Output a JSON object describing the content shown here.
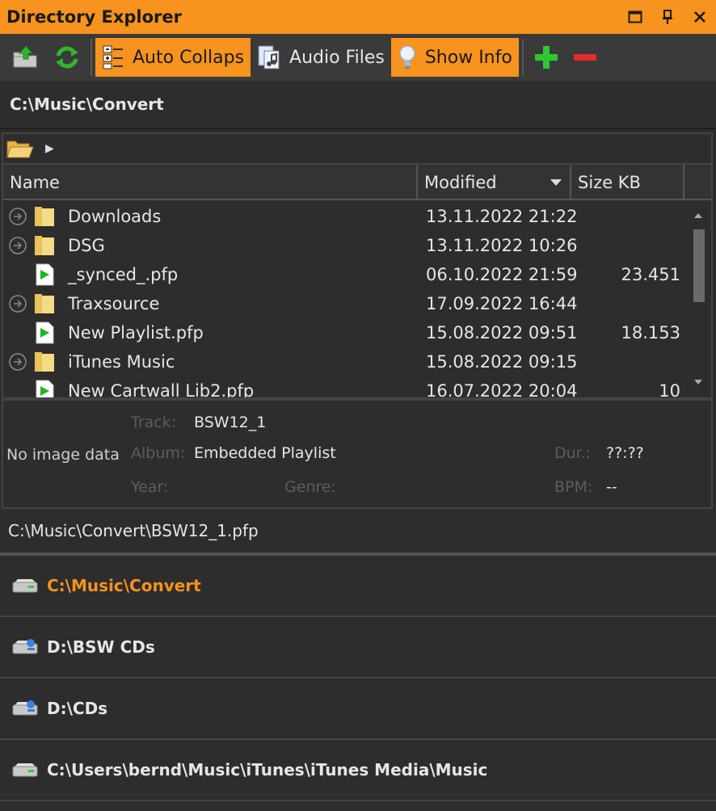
{
  "window": {
    "title": "Directory Explorer",
    "controls": [
      "maximize-icon",
      "pin-icon",
      "close-icon"
    ]
  },
  "toolbar": {
    "auto_collapse": "Auto Collaps",
    "audio_files": "Audio Files",
    "show_info": "Show Info"
  },
  "current_path": "C:\\Music\\Convert",
  "list": {
    "headers": {
      "name": "Name",
      "modified": "Modified",
      "size": "Size KB"
    },
    "rows": [
      {
        "type": "folder",
        "name": "Downloads",
        "modified": "13.11.2022 21:22",
        "size": ""
      },
      {
        "type": "folder",
        "name": "DSG",
        "modified": "13.11.2022 10:26",
        "size": ""
      },
      {
        "type": "playlist",
        "name": "_synced_.pfp",
        "modified": "06.10.2022 21:59",
        "size": "23.451"
      },
      {
        "type": "folder",
        "name": "Traxsource",
        "modified": "17.09.2022 16:44",
        "size": ""
      },
      {
        "type": "playlist",
        "name": "New Playlist.pfp",
        "modified": "15.08.2022 09:51",
        "size": "18.153"
      },
      {
        "type": "folder",
        "name": "iTunes Music",
        "modified": "15.08.2022 09:15",
        "size": ""
      },
      {
        "type": "playlist",
        "name": "New Cartwall Lib2.pfp",
        "modified": "16.07.2022 20:04",
        "size": "10"
      }
    ]
  },
  "info": {
    "no_image": "No image data",
    "track_label": "Track:",
    "track": "BSW12_1",
    "album_label": "Album:",
    "album": "Embedded Playlist",
    "year_label": "Year:",
    "genre_label": "Genre:",
    "dur_label": "Dur.:",
    "dur": "??:??",
    "bpm_label": "BPM:",
    "bpm": "--"
  },
  "selected_file_path": "C:\\Music\\Convert\\BSW12_1.pfp",
  "locations": [
    {
      "path": "C:\\Music\\Convert",
      "drive": "local",
      "current": true
    },
    {
      "path": "D:\\BSW CDs",
      "drive": "network",
      "current": false
    },
    {
      "path": "D:\\CDs",
      "drive": "network",
      "current": false
    },
    {
      "path": "C:\\Users\\bernd\\Music\\iTunes\\iTunes Media\\Music",
      "drive": "local",
      "current": false
    }
  ],
  "colors": {
    "accent": "#f7931e",
    "background": "#2d2d2d",
    "dim_label": "#5d5d5d"
  }
}
